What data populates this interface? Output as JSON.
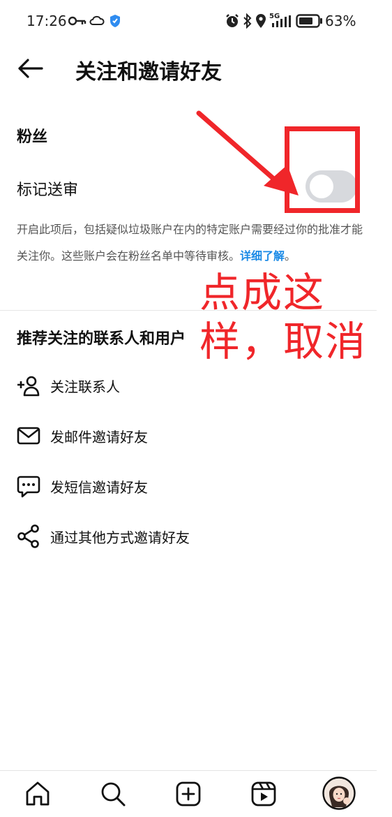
{
  "status_bar": {
    "time": "17:26",
    "network": "5G",
    "battery": "63%"
  },
  "header": {
    "title": "关注和邀请好友"
  },
  "followers": {
    "section_title": "粉丝",
    "flag_review_label": "标记送审",
    "toggle_state": "off",
    "description": "开启此项后，包括疑似垃圾账户在内的特定账户需要经过你的批准才能关注你。这些账户会在粉丝名单中等待审核。",
    "learn_more": "详细了解",
    "period": "。"
  },
  "recommend": {
    "section_title": "推荐关注的联系人和用户",
    "items": [
      {
        "label": "关注联系人",
        "icon": "add-person-icon"
      },
      {
        "label": "发邮件邀请好友",
        "icon": "mail-icon"
      },
      {
        "label": "发短信邀请好友",
        "icon": "chat-bubble-icon"
      },
      {
        "label": "通过其他方式邀请好友",
        "icon": "share-icon"
      }
    ]
  },
  "annotation": {
    "line1": "点成这",
    "line2": "样，取消",
    "color": "#f0262a"
  },
  "bottom_nav": [
    "home-icon",
    "search-icon",
    "create-icon",
    "reels-icon",
    "profile-avatar"
  ]
}
